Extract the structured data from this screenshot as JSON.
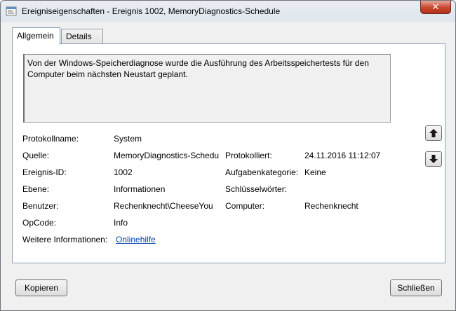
{
  "window": {
    "title": "Ereigniseigenschaften - Ereignis 1002, MemoryDiagnostics-Schedule",
    "close_label": "✕"
  },
  "tabs": [
    {
      "label": "Allgemein",
      "active": true
    },
    {
      "label": "Details",
      "active": false
    }
  ],
  "description": "Von der Windows-Speicherdiagnose wurde die Ausführung des Arbeitsspeichertests für den Computer beim nächsten Neustart geplant.",
  "fields": {
    "log_name": {
      "label": "Protokollname:",
      "value": "System"
    },
    "source": {
      "label": "Quelle:",
      "value": "MemoryDiagnostics-Schedu"
    },
    "logged": {
      "label": "Protokolliert:",
      "value": "24.11.2016 11:12:07"
    },
    "event_id": {
      "label": "Ereignis-ID:",
      "value": "1002"
    },
    "task_category": {
      "label": "Aufgabenkategorie:",
      "value": "Keine"
    },
    "level": {
      "label": "Ebene:",
      "value": "Informationen"
    },
    "keywords": {
      "label": "Schlüsselwörter:",
      "value": ""
    },
    "user": {
      "label": "Benutzer:",
      "value": "Rechenknecht\\CheeseYou"
    },
    "computer": {
      "label": "Computer:",
      "value": "Rechenknecht"
    },
    "opcode": {
      "label": "OpCode:",
      "value": "Info"
    },
    "more_info": {
      "label": "Weitere Informationen:",
      "link": "Onlinehilfe"
    }
  },
  "nav": {
    "up_icon": "arrow-up-icon",
    "down_icon": "arrow-down-icon"
  },
  "buttons": {
    "copy": "Kopieren",
    "close": "Schließen"
  },
  "colors": {
    "link": "#0645ad",
    "close_button": "#c7472f"
  }
}
